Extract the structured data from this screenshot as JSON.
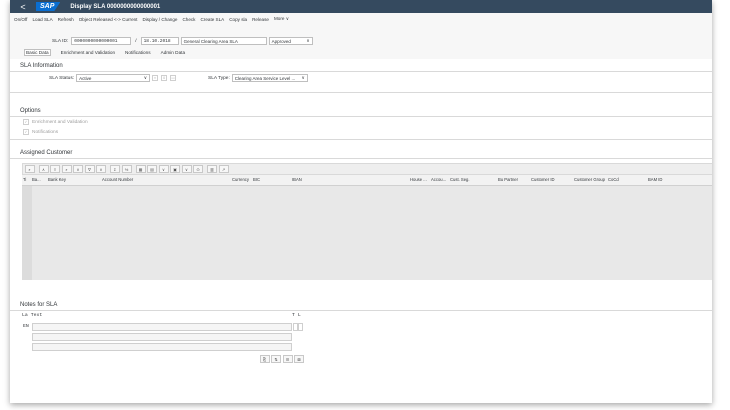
{
  "shell": {
    "back_icon": "back-icon",
    "logo": "SAP",
    "title": "Display SLA 0000000000000001"
  },
  "toolbar": [
    "On/Off",
    "Load SLA",
    "Refresh",
    "Object Released <-> Current",
    "Display / Change",
    "Check",
    "Create SLA",
    "Copy sla",
    "Release",
    "More ∨"
  ],
  "header": {
    "sla_id_label": "SLA ID:",
    "sla_id_value": "0000000000000001",
    "separator": "/",
    "date": "18.10.2018",
    "sla_name": "General Clearing Area SLA",
    "status": "Approved",
    "status_dropdown": "∨"
  },
  "tabs": [
    "Basic Data",
    "Enrichment and Validation",
    "Notifications",
    "Admin Data"
  ],
  "sla_info": {
    "title": "SLA Information",
    "status_label": "SLA Status:",
    "status_value": "Active",
    "type_label": "SLA Type:",
    "type_value": "Clearing Area Service Level ...",
    "dropdown_icon": "∨"
  },
  "options": {
    "title": "Options",
    "items": [
      "Enrichment and Validation",
      "Notifications"
    ]
  },
  "assigned_customer": {
    "title": "Assigned Customer",
    "toolbar_icons": [
      "⌕",
      "∧",
      "≡",
      "⌕",
      "∨",
      "∇",
      "∨",
      "Σ",
      "%",
      "▦",
      "▤",
      "∨",
      "▣",
      "∨",
      "⊙",
      "▥",
      "↗"
    ],
    "columns": [
      "Ti",
      "Ba...",
      "Bank Key",
      "Account Number",
      "Currency",
      "BIC",
      "IBAN",
      "House ...",
      "Accou...",
      "Cust. Seg.",
      "Bu Partner",
      "Customer ID",
      "Customer Group",
      "CoCd",
      "BAM ID"
    ]
  },
  "notes": {
    "title": "Notes for SLA",
    "col_la": "La",
    "col_text": "Text",
    "col_t": "T",
    "col_l": "L",
    "lang": "EN"
  }
}
